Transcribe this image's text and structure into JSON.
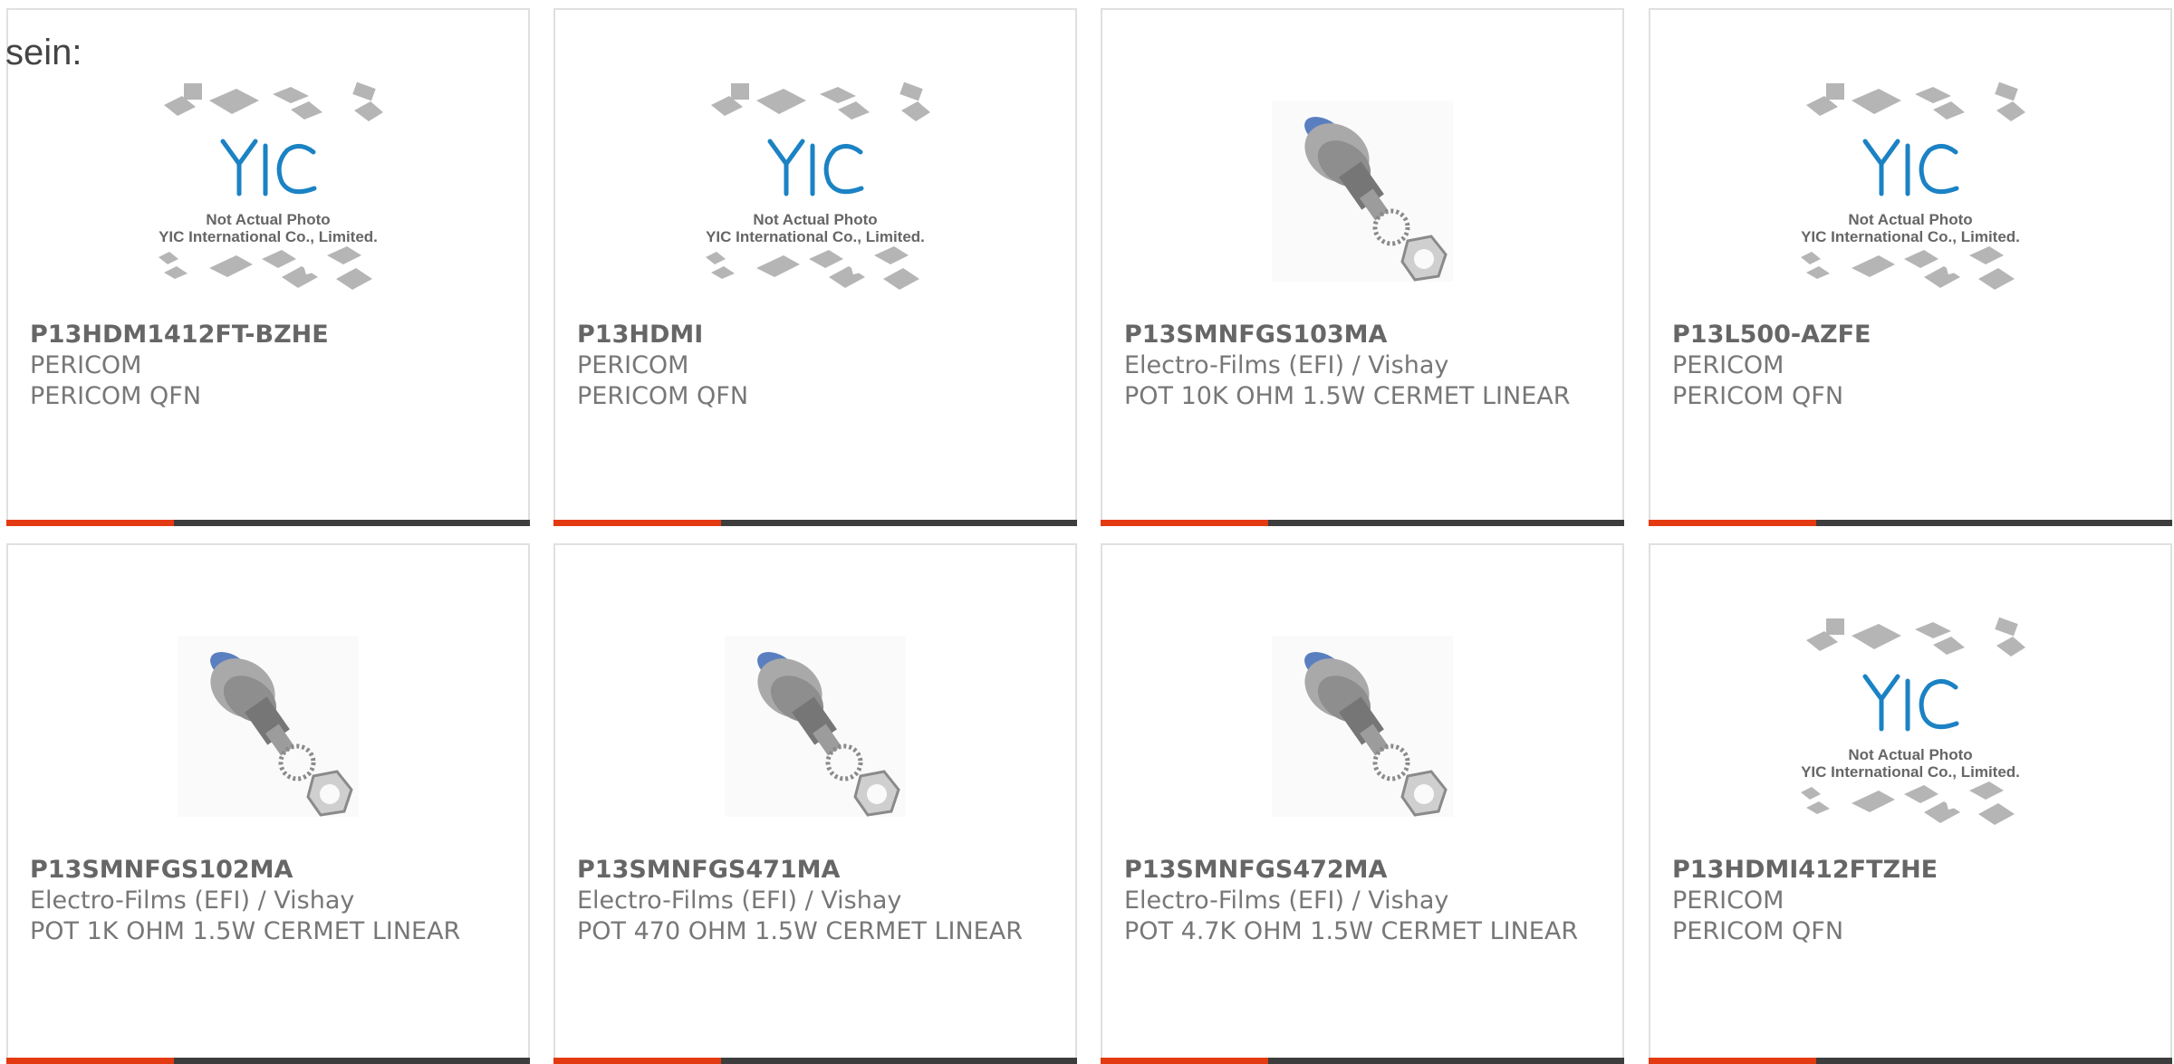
{
  "lead_text": "sein:",
  "accent_color": "#e43a12",
  "products": [
    {
      "part": "P13HDM1412FT-BZHE",
      "mfr": "PERICOM",
      "desc": "PERICOM QFN",
      "image": "placeholder",
      "ph_line1": "Not Actual Photo",
      "ph_line2": "YIC International Co., Limited."
    },
    {
      "part": "P13HDMI",
      "mfr": "PERICOM",
      "desc": "PERICOM QFN",
      "image": "placeholder",
      "ph_line1": "Not Actual Photo",
      "ph_line2": "YIC International Co., Limited."
    },
    {
      "part": "P13SMNFGS103MA",
      "mfr": "Electro-Films (EFI) / Vishay",
      "desc": "POT 10K OHM 1.5W CERMET LINEAR",
      "image": "potentiometer-photo"
    },
    {
      "part": "P13L500-AZFE",
      "mfr": "PERICOM",
      "desc": "PERICOM QFN",
      "image": "placeholder",
      "ph_line1": "Not Actual Photo",
      "ph_line2": "YIC International Co., Limited."
    },
    {
      "part": "P13SMNFGS102MA",
      "mfr": "Electro-Films (EFI) / Vishay",
      "desc": "POT 1K OHM 1.5W CERMET LINEAR",
      "image": "potentiometer-photo"
    },
    {
      "part": "P13SMNFGS471MA",
      "mfr": "Electro-Films (EFI) / Vishay",
      "desc": "POT 470 OHM 1.5W CERMET LINEAR",
      "image": "potentiometer-photo"
    },
    {
      "part": "P13SMNFGS472MA",
      "mfr": "Electro-Films (EFI) / Vishay",
      "desc": "POT 4.7K OHM 1.5W CERMET LINEAR",
      "image": "potentiometer-photo"
    },
    {
      "part": "P13HDMI412FTZHE",
      "mfr": "PERICOM",
      "desc": "PERICOM QFN",
      "image": "placeholder",
      "ph_line1": "Not Actual Photo",
      "ph_line2": "YIC International Co., Limited."
    }
  ]
}
